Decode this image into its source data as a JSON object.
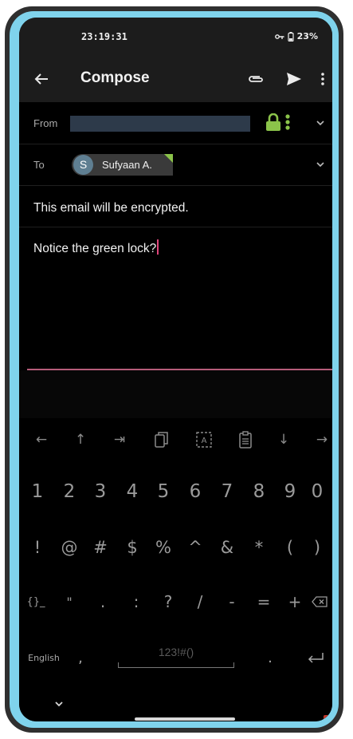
{
  "status_bar": {
    "time": "23:19:31",
    "battery": "23%"
  },
  "app_bar": {
    "title": "Compose"
  },
  "from_row": {
    "label": "From"
  },
  "to_row": {
    "label": "To",
    "recipient_initial": "S",
    "recipient_name": "Sufyaan A."
  },
  "subject": {
    "text": "This email will be encrypted."
  },
  "body": {
    "text": "Notice the green lock?"
  },
  "keyboard": {
    "nav_keys": [
      "←",
      "↑",
      "⇥",
      "copy-icon",
      "select-all-icon",
      "paste-icon",
      "↓",
      "→"
    ],
    "number_keys": [
      "1",
      "2",
      "3",
      "4",
      "5",
      "6",
      "7",
      "8",
      "9",
      "0"
    ],
    "symbol_keys": [
      "!",
      "@",
      "#",
      "$",
      "%",
      "^",
      "&",
      "*",
      "(",
      ")"
    ],
    "symbol_keys_2": [
      "{}_",
      "\"",
      ".",
      ":",
      "?",
      "/",
      "-",
      "=",
      "+"
    ],
    "language": "English",
    "comma": ",",
    "space_label": "123!#()",
    "period": "."
  },
  "colors": {
    "accent_lock": "#8bc34a",
    "caret": "#e0457b",
    "frame": "#7fd3ec"
  }
}
